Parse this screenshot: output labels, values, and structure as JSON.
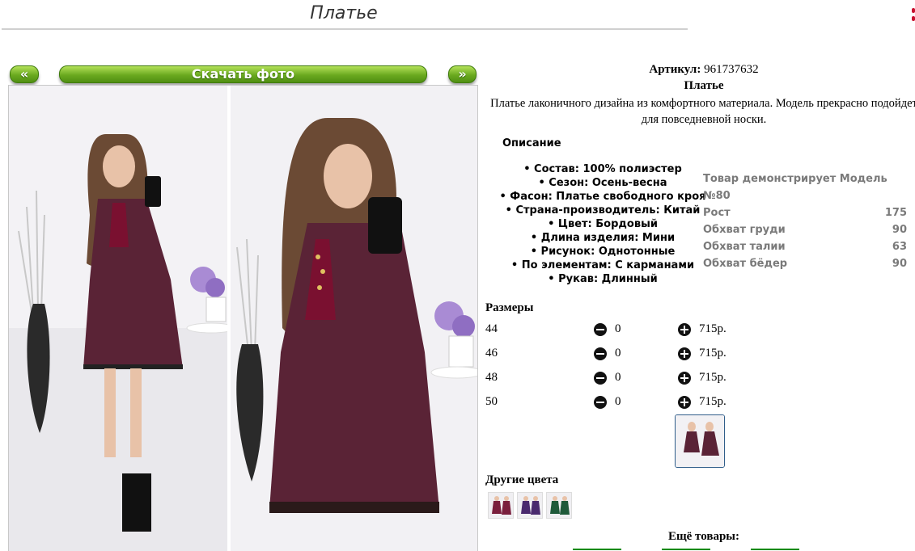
{
  "header": {
    "title": "Платье"
  },
  "gallery": {
    "prev_label": "«",
    "next_label": "»",
    "download_label": "Скачать фото"
  },
  "product": {
    "article_label": "Артикул:",
    "article_value": "961737632",
    "name": "Платье",
    "description": "Платье лаконичного дизайна из комфортного материала. Модель прекрасно подойдет для повседневной носки.",
    "description_heading": "Описание",
    "attributes": [
      "Состав: 100% полиэстер",
      "Сезон: Осень-весна",
      "Фасон: Платье свободного кроя",
      "Страна-производитель: Китай",
      "Цвет: Бордовый",
      "Длина изделия: Мини",
      "Рисунок: Однотонные",
      "По элементам: С карманами",
      "Рукав: Длинный"
    ]
  },
  "model": {
    "rows": [
      {
        "label": "Товар демонстрирует Модель №80",
        "value": ""
      },
      {
        "label": "Рост",
        "value": "175"
      },
      {
        "label": "Обхват груди",
        "value": "90"
      },
      {
        "label": "Обхват талии",
        "value": "63"
      },
      {
        "label": "Обхват бёдер",
        "value": "90"
      }
    ]
  },
  "sizes": {
    "heading": "Размеры",
    "rows": [
      {
        "size": "44",
        "qty": "0",
        "price": "715р."
      },
      {
        "size": "46",
        "qty": "0",
        "price": "715р."
      },
      {
        "size": "48",
        "qty": "0",
        "price": "715р."
      },
      {
        "size": "50",
        "qty": "0",
        "price": "715р."
      }
    ]
  },
  "other_colors": {
    "heading": "Другие цвета",
    "swatches": [
      "#7a1f3d",
      "#4a2a6e",
      "#1f5a3a"
    ]
  },
  "more": {
    "heading": "Ещё товары:"
  },
  "colors": {
    "accent_green": "#6aa91f",
    "dress": "#5a2336",
    "link_green": "#0a8a0a"
  }
}
